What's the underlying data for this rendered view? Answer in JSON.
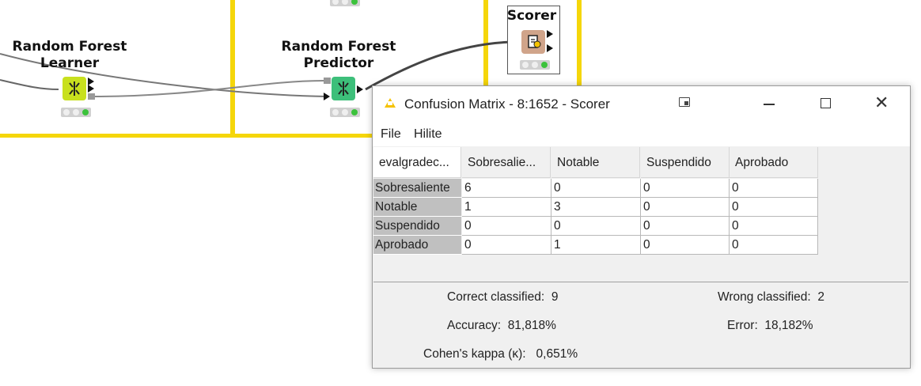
{
  "workflow": {
    "nodes": {
      "learner": {
        "label_line1": "Random Forest",
        "label_line2": "Learner",
        "color": "#c8e01e"
      },
      "predictor": {
        "label_line1": "Random Forest",
        "label_line2": "Predictor",
        "color": "#3dbf7a"
      },
      "scorer": {
        "label": "Scorer",
        "color": "#d0a48a"
      }
    },
    "accent_color": "#f5d60a"
  },
  "dialog": {
    "title": "Confusion Matrix - 8:1652 - Scorer",
    "menu": {
      "file": "File",
      "hilite": "Hilite"
    },
    "table": {
      "corner_header": "evalgradec...",
      "columns": [
        "Sobresalie...",
        "Notable",
        "Suspendido",
        "Aprobado"
      ],
      "rows": [
        {
          "label": "Sobresaliente",
          "values": [
            "6",
            "0",
            "0",
            "0"
          ]
        },
        {
          "label": "Notable",
          "values": [
            "1",
            "3",
            "0",
            "0"
          ]
        },
        {
          "label": "Suspendido",
          "values": [
            "0",
            "0",
            "0",
            "0"
          ]
        },
        {
          "label": "Aprobado",
          "values": [
            "0",
            "1",
            "0",
            "0"
          ]
        }
      ]
    },
    "stats": {
      "correct_label": "Correct classified:",
      "correct_value": "9",
      "wrong_label": "Wrong classified:",
      "wrong_value": "2",
      "accuracy_label": "Accuracy:",
      "accuracy_value": "81,818%",
      "error_label": "Error:",
      "error_value": "18,182%",
      "kappa_label": "Cohen's kappa (κ):",
      "kappa_value": "0,651%"
    }
  }
}
